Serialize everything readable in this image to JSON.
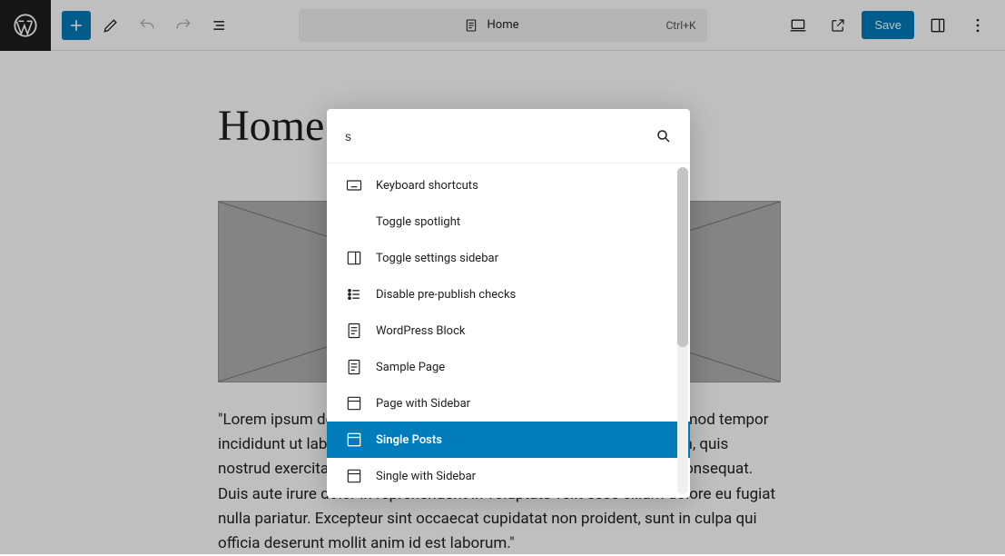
{
  "header": {
    "doc_title": "Home",
    "shortcut": "Ctrl+K",
    "save_label": "Save"
  },
  "content": {
    "heading": "Home",
    "body": "\"Lorem ipsum dolor sit amet, consectetur adipiscing elit, sed do eiusmod tempor incididunt ut labore et dolore magna aliqua. Ut enim ad minim veniam, quis nostrud exercitation ullamco laboris nisi ut aliquip ex ea commodo consequat. Duis aute irure dolor in reprehenderit in voluptate velit esse cillum dolore eu fugiat nulla pariatur. Excepteur sint occaecat cupidatat non proident, sunt in culpa qui officia deserunt mollit anim id est laborum.\""
  },
  "palette": {
    "query": "s",
    "items": [
      {
        "label": "Keyboard shortcuts",
        "icon": "keyboard-icon"
      },
      {
        "label": "Toggle spotlight",
        "icon": ""
      },
      {
        "label": "Toggle settings sidebar",
        "icon": "sidebar-icon"
      },
      {
        "label": "Disable pre-publish checks",
        "icon": "checklist-icon"
      },
      {
        "label": "WordPress Block",
        "icon": "page-icon"
      },
      {
        "label": "Sample Page",
        "icon": "page-icon"
      },
      {
        "label": "Page with Sidebar",
        "icon": "layout-icon"
      },
      {
        "label": "Single Posts",
        "icon": "layout-icon",
        "selected": true
      },
      {
        "label": "Single with Sidebar",
        "icon": "layout-icon"
      }
    ]
  }
}
